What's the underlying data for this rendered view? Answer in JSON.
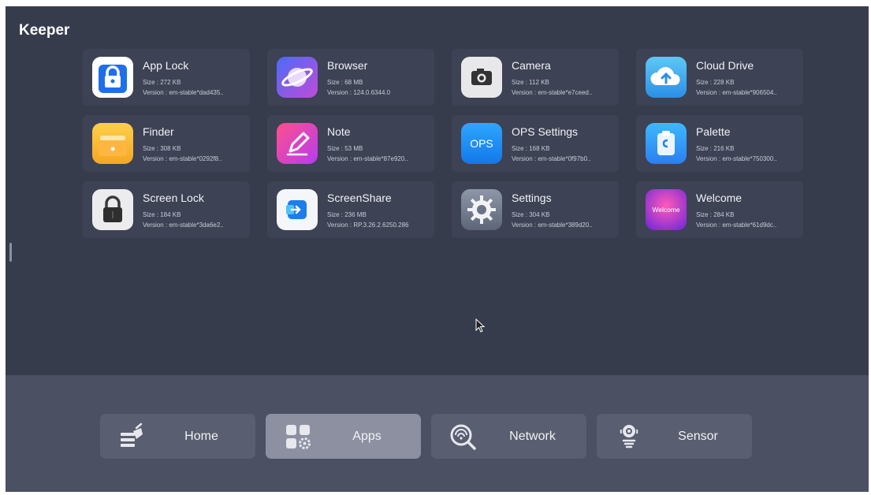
{
  "header": {
    "title": "Keeper"
  },
  "apps": [
    {
      "name": "App Lock",
      "size": "Size : 272 KB",
      "version": "Version : em-stable*dad435..",
      "icon": "padlock-icon"
    },
    {
      "name": "Browser",
      "size": "Size : 68 MB",
      "version": "Version : 124.0.6344.0",
      "icon": "planet-icon"
    },
    {
      "name": "Camera",
      "size": "Size : 112 KB",
      "version": "Version : em-stable*e7ceed..",
      "icon": "camera-icon"
    },
    {
      "name": "Cloud Drive",
      "size": "Size : 228 KB",
      "version": "Version : em-stable*906504..",
      "icon": "cloud-upload-icon"
    },
    {
      "name": "Finder",
      "size": "Size : 308 KB",
      "version": "Version : em-stable*0292f8..",
      "icon": "folder-icon"
    },
    {
      "name": "Note",
      "size": "Size : 53 MB",
      "version": "Version : em-stable*87e920..",
      "icon": "pen-icon"
    },
    {
      "name": "OPS Settings",
      "size": "Size : 168 KB",
      "version": "Version : em-stable*0f97b0..",
      "icon": "ops-icon",
      "icon_text": "OPS"
    },
    {
      "name": "Palette",
      "size": "Size : 216 KB",
      "version": "Version : em-stable*750300..",
      "icon": "clipboard-icon"
    },
    {
      "name": "Screen Lock",
      "size": "Size : 184 KB",
      "version": "Version : em-stable*3da6e2..",
      "icon": "lock-icon"
    },
    {
      "name": "ScreenShare",
      "size": "Size : 236 MB",
      "version": "Version : RP.3.26.2.6250.286",
      "icon": "screenshare-icon"
    },
    {
      "name": "Settings",
      "size": "Size : 304 KB",
      "version": "Version : em-stable*389d20..",
      "icon": "gear-icon"
    },
    {
      "name": "Welcome",
      "size": "Size : 284 KB",
      "version": "Version : em-stable*61d9dc..",
      "icon": "welcome-icon",
      "icon_text": "Welcome"
    }
  ],
  "nav": [
    {
      "label": "Home",
      "icon": "broom-icon",
      "active": false
    },
    {
      "label": "Apps",
      "icon": "apps-grid-icon",
      "active": true
    },
    {
      "label": "Network",
      "icon": "network-search-icon",
      "active": false
    },
    {
      "label": "Sensor",
      "icon": "sensor-icon",
      "active": false
    }
  ]
}
